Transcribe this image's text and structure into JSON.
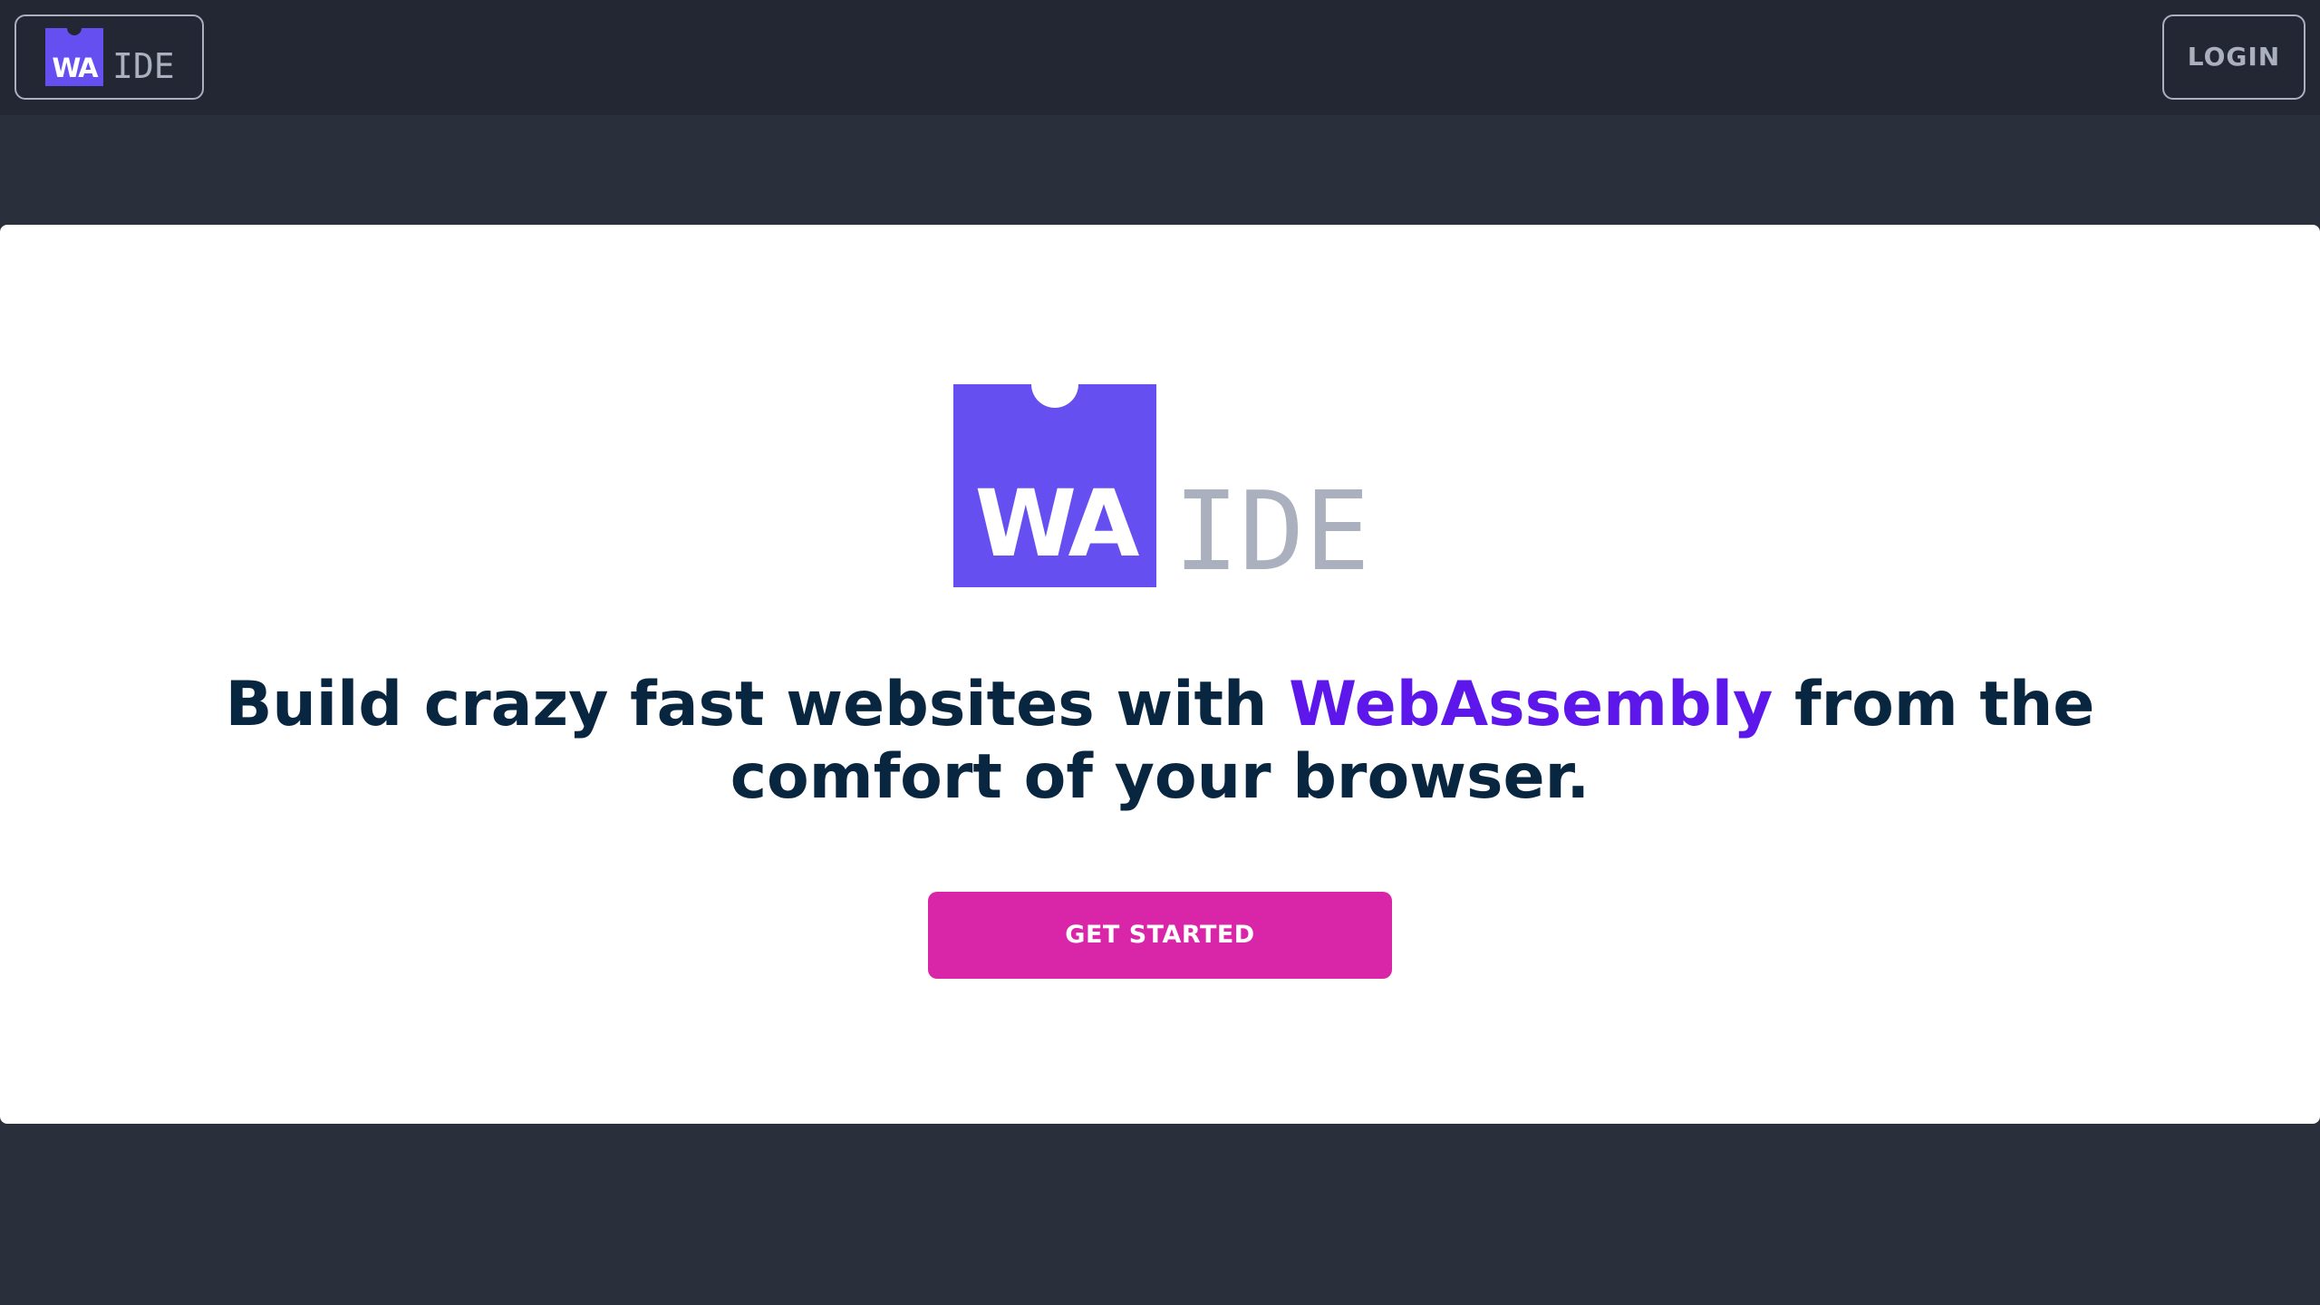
{
  "header": {
    "logo": {
      "mark_text": "WA",
      "product_text": "IDE",
      "brand_color": "#654ff0"
    },
    "login_label": "LOGIN"
  },
  "hero": {
    "logo": {
      "mark_text": "WA",
      "product_text": "IDE"
    },
    "headline_before": "Build crazy fast websites with ",
    "headline_accent": "WebAssembly",
    "headline_after": " from the comfort of your browser.",
    "accent_color": "#5e17eb",
    "cta_label": "GET STARTED",
    "cta_color": "#d926a8"
  },
  "icons": {
    "header_logo": "webassembly-logo-icon",
    "hero_logo": "webassembly-logo-icon"
  }
}
